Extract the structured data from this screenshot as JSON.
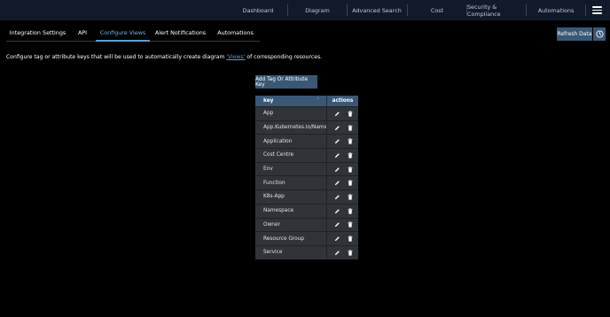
{
  "topnav": {
    "items": [
      {
        "label": "Dashboard"
      },
      {
        "label": "Diagram"
      },
      {
        "label": "Advanced Search"
      },
      {
        "label": "Cost"
      },
      {
        "label": "Security & Compliance"
      },
      {
        "label": "Automations"
      }
    ],
    "menu_icon": "hamburger-menu-icon"
  },
  "subnav": {
    "tabs": [
      {
        "label": "Integration Settings"
      },
      {
        "label": "API"
      },
      {
        "label": "Configure Views",
        "active": true
      },
      {
        "label": "Alert Notifications"
      },
      {
        "label": "Automations"
      }
    ]
  },
  "toolbar": {
    "refresh_label": "Refresh Data",
    "clock_icon": "clock-icon"
  },
  "description": {
    "before": "Configure tag or attribute keys that will be used to automatically create diagram",
    "link": "'Views'",
    "after": "of corresponding resources."
  },
  "add_button": {
    "label": "Add Tag Or Attribute Key"
  },
  "table": {
    "headers": {
      "key": "key",
      "actions": "actions"
    },
    "sort_icon": "sort-icon",
    "rows": [
      {
        "key": "App"
      },
      {
        "key": "App.Kubernetes.Io/Name"
      },
      {
        "key": "Application"
      },
      {
        "key": "Cost Centre"
      },
      {
        "key": "Env"
      },
      {
        "key": "Function"
      },
      {
        "key": "K8s-App"
      },
      {
        "key": "Namespace"
      },
      {
        "key": "Owner"
      },
      {
        "key": "Resource Group"
      },
      {
        "key": "Service"
      }
    ]
  },
  "colors": {
    "accent": "#4fa3d8",
    "button_bg": "#3a5876",
    "nav_bg": "#101a2a",
    "row_bg": "#303338"
  }
}
